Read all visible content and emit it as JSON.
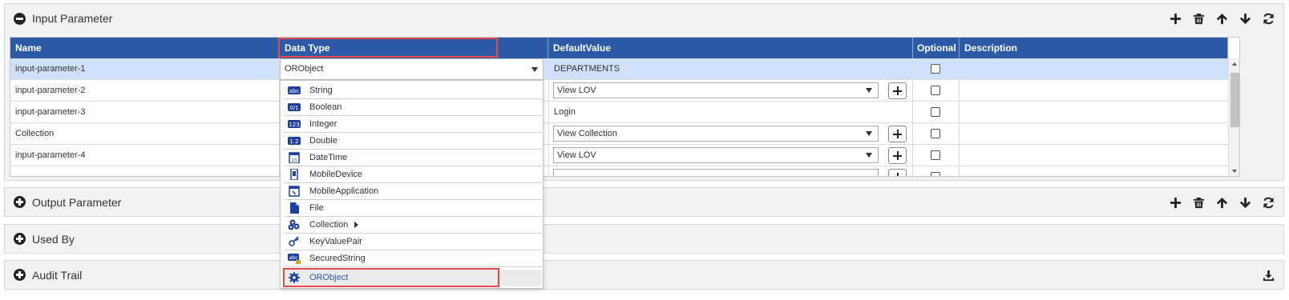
{
  "panels": {
    "input": {
      "title": "Input Parameter"
    },
    "output": {
      "title": "Output Parameter"
    },
    "used_by": {
      "title": "Used By"
    },
    "audit": {
      "title": "Audit Trail"
    }
  },
  "table": {
    "headers": [
      "Name",
      "Data Type",
      "DefaultValue",
      "Optional",
      "Description"
    ],
    "rows": [
      {
        "name": "input-parameter-1",
        "default": "DEPARTMENTS"
      },
      {
        "name": "input-parameter-2",
        "default": "View LOV"
      },
      {
        "name": "input-parameter-3",
        "default": "Login"
      },
      {
        "name": "Collection",
        "default": "View Collection"
      },
      {
        "name": "input-parameter-4",
        "default": "View LOV"
      }
    ]
  },
  "dropdown": {
    "selected": "ORObject",
    "options": [
      "String",
      "Boolean",
      "Integer",
      "Double",
      "DateTime",
      "MobileDevice",
      "MobileApplication",
      "File",
      "Collection",
      "KeyValuePair",
      "SecuredString",
      "ORObject"
    ],
    "icons": [
      "abc-icon",
      "boolean-icon",
      "integer-icon",
      "double-icon",
      "datetime-icon",
      "mobile-device-icon",
      "mobile-application-icon",
      "file-icon",
      "collection-icon",
      "key-value-pair-icon",
      "secured-string-icon",
      "orobject-icon"
    ]
  },
  "colors": {
    "header": "#2d5aa6",
    "selected_row": "#cfe0fb",
    "highlight": "#e04a4a",
    "icon": "#1f3fa0"
  }
}
